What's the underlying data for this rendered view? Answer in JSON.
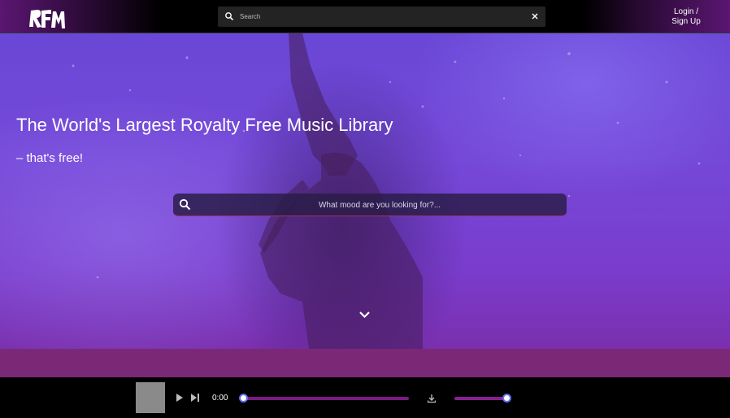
{
  "header": {
    "logo_icon": "rfm-logo-icon",
    "search": {
      "placeholder": "Search",
      "value": "",
      "icon": "search-icon",
      "clear_icon": "close-icon"
    },
    "login_line1": "Login /",
    "login_line2": "Sign Up"
  },
  "hero": {
    "title": "The World's Largest Royalty Free Music Library",
    "subtitle": "– that's free!",
    "search": {
      "placeholder": "What mood are you looking for?...",
      "value": "",
      "icon": "search-icon"
    },
    "scroll_icon": "chevron-down-icon"
  },
  "player": {
    "time": "0:00",
    "progress": 0,
    "volume": 1.0,
    "icons": [
      "play-icon",
      "skip-next-icon",
      "download-icon"
    ]
  },
  "colors": {
    "accent": "#8a1f94",
    "band": "#7b2877",
    "hero_base": "#7548d8",
    "slider_knob_border": "#5b6df0"
  }
}
